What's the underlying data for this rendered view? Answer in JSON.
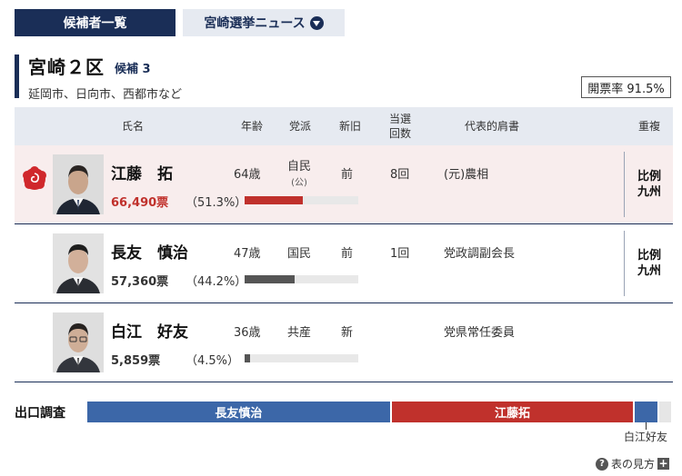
{
  "tabs": {
    "candidates": "候補者一覧",
    "news": "宮崎選挙ニュース"
  },
  "district": {
    "name": "宮崎２区",
    "count": "候補 3",
    "area": "延岡市、日向市、西都市など",
    "rate": "開票率 91.5%"
  },
  "columns": {
    "name": "氏名",
    "age": "年齢",
    "party": "党派",
    "status": "新旧",
    "wins_1": "当選",
    "wins_2": "回数",
    "title": "代表的肩書",
    "dup": "重複"
  },
  "candidates": [
    {
      "name": "江藤　拓",
      "votes": "66,490票",
      "percent": "（51.3%）",
      "share": 51.3,
      "age": "64歳",
      "party": "自民",
      "party_sub": "(公)",
      "status": "前",
      "wins": "8回",
      "title": "(元)農相",
      "dup_1": "比例",
      "dup_2": "九州",
      "elected": true,
      "bar_color": "#c0312c"
    },
    {
      "name": "長友　慎治",
      "votes": "57,360票",
      "percent": "（44.2%）",
      "share": 44.2,
      "age": "47歳",
      "party": "国民",
      "party_sub": "",
      "status": "前",
      "wins": "1回",
      "title": "党政調副会長",
      "dup_1": "比例",
      "dup_2": "九州",
      "elected": false,
      "bar_color": "#555555"
    },
    {
      "name": "白江　好友",
      "votes": "5,859票",
      "percent": "（4.5%）",
      "share": 4.5,
      "age": "36歳",
      "party": "共産",
      "party_sub": "",
      "status": "新",
      "wins": "",
      "title": "党県常任委員",
      "dup_1": "",
      "dup_2": "",
      "elected": false,
      "bar_color": "#555555"
    }
  ],
  "exit_poll": {
    "label": "出口調査",
    "segments": [
      {
        "label": "長友慎治",
        "share": 52.0,
        "color": "#3c67a8"
      },
      {
        "label": "江藤拓",
        "share": 41.5,
        "color": "#c0312c"
      },
      {
        "label": "",
        "share": 4.2,
        "color": "#3c67a8"
      },
      {
        "label": "",
        "share": 2.3,
        "color": "#e6e6e6"
      }
    ],
    "small_label": "白江好友"
  },
  "help": {
    "label": "表の見方"
  }
}
